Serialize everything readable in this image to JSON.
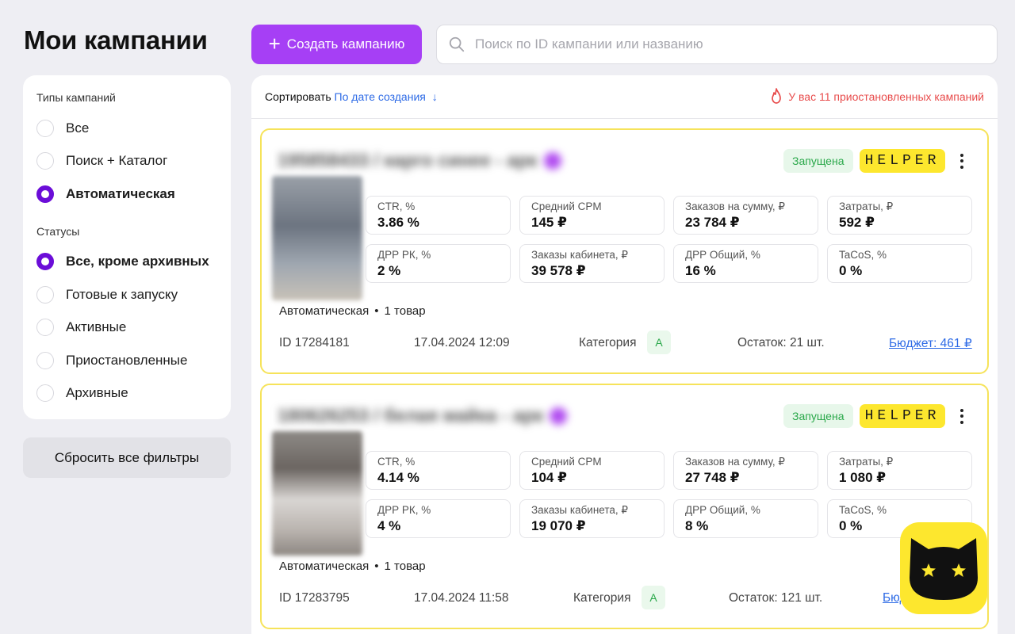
{
  "page": {
    "title": "Мои кампании"
  },
  "toolbar": {
    "create_label": "Создать кампанию",
    "search_placeholder": "Поиск по ID кампании или названию",
    "search_value": ""
  },
  "filters": {
    "types_label": "Типы кампаний",
    "types": [
      {
        "label": "Все",
        "checked": false
      },
      {
        "label": "Поиск + Каталог",
        "checked": false
      },
      {
        "label": "Автоматическая",
        "checked": true
      }
    ],
    "statuses_label": "Статусы",
    "statuses": [
      {
        "label": "Все, кроме архивных",
        "checked": true
      },
      {
        "label": "Готовые к запуску",
        "checked": false
      },
      {
        "label": "Активные",
        "checked": false
      },
      {
        "label": "Приостановленные",
        "checked": false
      },
      {
        "label": "Архивные",
        "checked": false
      }
    ],
    "reset_label": "Сбросить все фильтры"
  },
  "sortbar": {
    "sort_label": "Сортировать",
    "sort_value": "По дате создания",
    "sort_arrow": "↓",
    "warning": "У вас 11 приостановленных кампаний"
  },
  "colors": {
    "accent": "#a63ff5",
    "radio": "#6b0dd8",
    "helper": "#fde72e",
    "link": "#2e6be6",
    "warning": "#e84c4c"
  },
  "campaigns": [
    {
      "name": "195858433 / карго синее - арк",
      "status": "Запущена",
      "helper": "HELPER",
      "metrics": [
        {
          "label": "CTR, %",
          "value": "3.86 %"
        },
        {
          "label": "Средний CPM",
          "value": "145 ₽"
        },
        {
          "label": "Заказов на сумму, ₽",
          "value": "23 784 ₽"
        },
        {
          "label": "Затраты, ₽",
          "value": "592 ₽"
        },
        {
          "label": "ДРР РК, %",
          "value": "2 %"
        },
        {
          "label": "Заказы кабинета, ₽",
          "value": "39 578 ₽"
        },
        {
          "label": "ДРР Общий, %",
          "value": "16 %"
        },
        {
          "label": "TaCoS, %",
          "value": "0 %"
        }
      ],
      "type": "Автоматическая",
      "bullet": "•",
      "items": "1 товар",
      "id": "ID 17284181",
      "date": "17.04.2024 12:09",
      "category_label": "Категория",
      "category": "A",
      "stock": "Остаток: 21 шт.",
      "budget": "Бюджет: 461 ₽"
    },
    {
      "name": "180626253 / белая майка - арк",
      "status": "Запущена",
      "helper": "HELPER",
      "metrics": [
        {
          "label": "CTR, %",
          "value": "4.14 %"
        },
        {
          "label": "Средний CPM",
          "value": "104 ₽"
        },
        {
          "label": "Заказов на сумму, ₽",
          "value": "27 748 ₽"
        },
        {
          "label": "Затраты, ₽",
          "value": "1 080 ₽"
        },
        {
          "label": "ДРР РК, %",
          "value": "4 %"
        },
        {
          "label": "Заказы кабинета, ₽",
          "value": "19 070 ₽"
        },
        {
          "label": "ДРР Общий, %",
          "value": "8 %"
        },
        {
          "label": "TaCoS, %",
          "value": "0 %"
        }
      ],
      "type": "Автоматическая",
      "bullet": "•",
      "items": "1 товар",
      "id": "ID 17283795",
      "date": "17.04.2024 11:58",
      "category_label": "Категория",
      "category": "A",
      "stock": "Остаток: 121 шт.",
      "budget": "Бюдж"
    }
  ]
}
